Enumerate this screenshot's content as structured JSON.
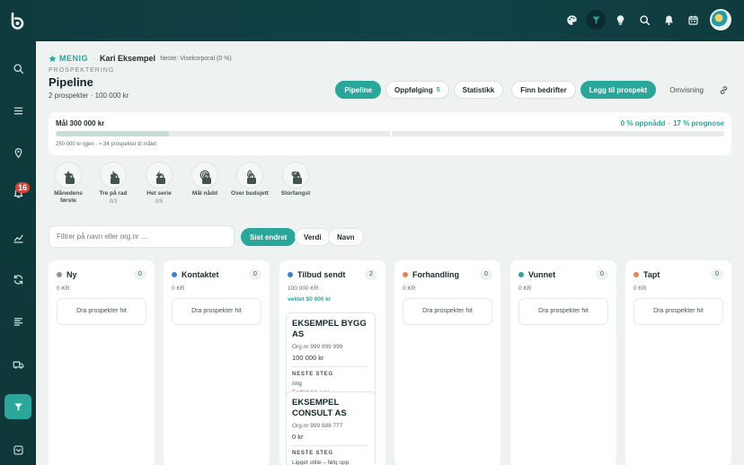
{
  "header": {
    "rank": "MENIG",
    "person": "Kari Eksempel",
    "next_rank": "Neste: Visekorporal (0 %)",
    "breadcrumb": "PROSPEKTERING",
    "title": "Pipeline",
    "subtitle": "2 prospekter · 100 000 kr"
  },
  "actions": {
    "pipeline": "Pipeline",
    "followup": "Oppfølging",
    "followup_count": "5",
    "stats": "Statistikk",
    "find": "Finn bedrifter",
    "add": "Legg til prospekt",
    "turnover": "Omvisning"
  },
  "goal": {
    "title": "Mål 300 000 kr",
    "achieved": "0 % oppnådd",
    "forecast": "17 % prognose",
    "progress_fraction": 0.17,
    "note": "250 000 kr igjen · ≈ 34 prospekter til målet"
  },
  "achievements": [
    {
      "label": "Månedens første",
      "progress": "",
      "icon": "star-icon"
    },
    {
      "label": "Tre på rad",
      "progress": "0/3",
      "icon": "flame-icon"
    },
    {
      "label": "Het serie",
      "progress": "0/5",
      "icon": "bolt-icon"
    },
    {
      "label": "Mål nådd",
      "progress": "",
      "icon": "target-icon"
    },
    {
      "label": "Over budsjett",
      "progress": "",
      "icon": "rocket-icon"
    },
    {
      "label": "Storfangst",
      "progress": "",
      "icon": "diamond-icon"
    }
  ],
  "filter": {
    "placeholder": "Filtrer på navn eller org.nr ...",
    "sort_options": [
      "Sist endret",
      "Verdi",
      "Navn"
    ],
    "active_sort": "Sist endret"
  },
  "columns": [
    {
      "name": "Ny",
      "count": "0",
      "amount": "0 KR",
      "color": "#8c9795",
      "drop": "Dra prospekter hit"
    },
    {
      "name": "Kontaktet",
      "count": "0",
      "amount": "0 KR",
      "color": "#3b7fd4",
      "drop": "Dra prospekter hit"
    },
    {
      "name": "Tilbud sendt",
      "count": "2",
      "amount": "100 000 KR",
      "weighted": "vektet 50 000 kr",
      "color": "#3b7fd4",
      "cards": [
        {
          "name": "EKSEMPEL BYGG AS",
          "org": "Org.nr 999 999 999",
          "amount": "100 000 kr",
          "step_label": "NESTE STEG",
          "step": "ring",
          "due": "Forfalt 14. juni"
        },
        {
          "name": "EKSEMPEL CONSULT AS",
          "org": "Org.nr 999 888 777",
          "amount": "0 kr",
          "step_label": "NESTE STEG",
          "step": "Ligget stille – følg opp"
        }
      ]
    },
    {
      "name": "Forhandling",
      "count": "0",
      "amount": "0 KR",
      "color": "#e8845a",
      "drop": "Dra prospekter hit"
    },
    {
      "name": "Vunnet",
      "count": "0",
      "amount": "0 KR",
      "color": "#2aa79a",
      "drop": "Dra prospekter hit"
    },
    {
      "name": "Tapt",
      "count": "0",
      "amount": "0 KR",
      "color": "#e8845a",
      "drop": "Dra prospekter hit"
    }
  ],
  "sidebar": {
    "notification_count": "16",
    "items": [
      "search-icon",
      "list-icon",
      "map-pin-icon",
      "notifications-icon",
      "chart-icon",
      "refresh-icon",
      "document-list-icon",
      "truck-icon",
      "filter-icon",
      "chevron-down-icon"
    ]
  },
  "colors": {
    "accent": "#2aa79a",
    "dark": "#0f3b3e",
    "danger": "#d0463a"
  }
}
